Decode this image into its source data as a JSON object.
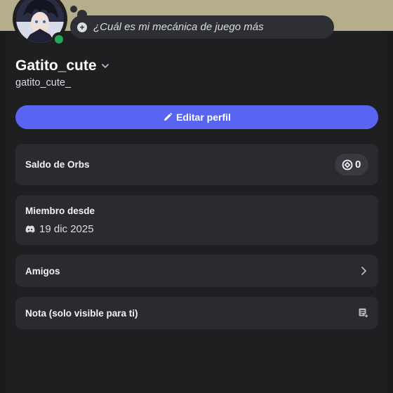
{
  "status": {
    "text": "¿Cuál es mi mecánica de juego más"
  },
  "profile": {
    "display_name": "Gatito_cute",
    "username": "gatito_cute_",
    "online_color": "#23a55a"
  },
  "actions": {
    "edit_profile_label": "Editar perfil"
  },
  "orbs": {
    "label": "Saldo de Orbs",
    "balance": "0"
  },
  "member_since": {
    "label": "Miembro desde",
    "date": "19 dic 2025"
  },
  "friends": {
    "label": "Amigos"
  },
  "note": {
    "label": "Nota (solo visible para ti)"
  },
  "colors": {
    "accent": "#5865f2",
    "banner": "#b6ad8a"
  }
}
